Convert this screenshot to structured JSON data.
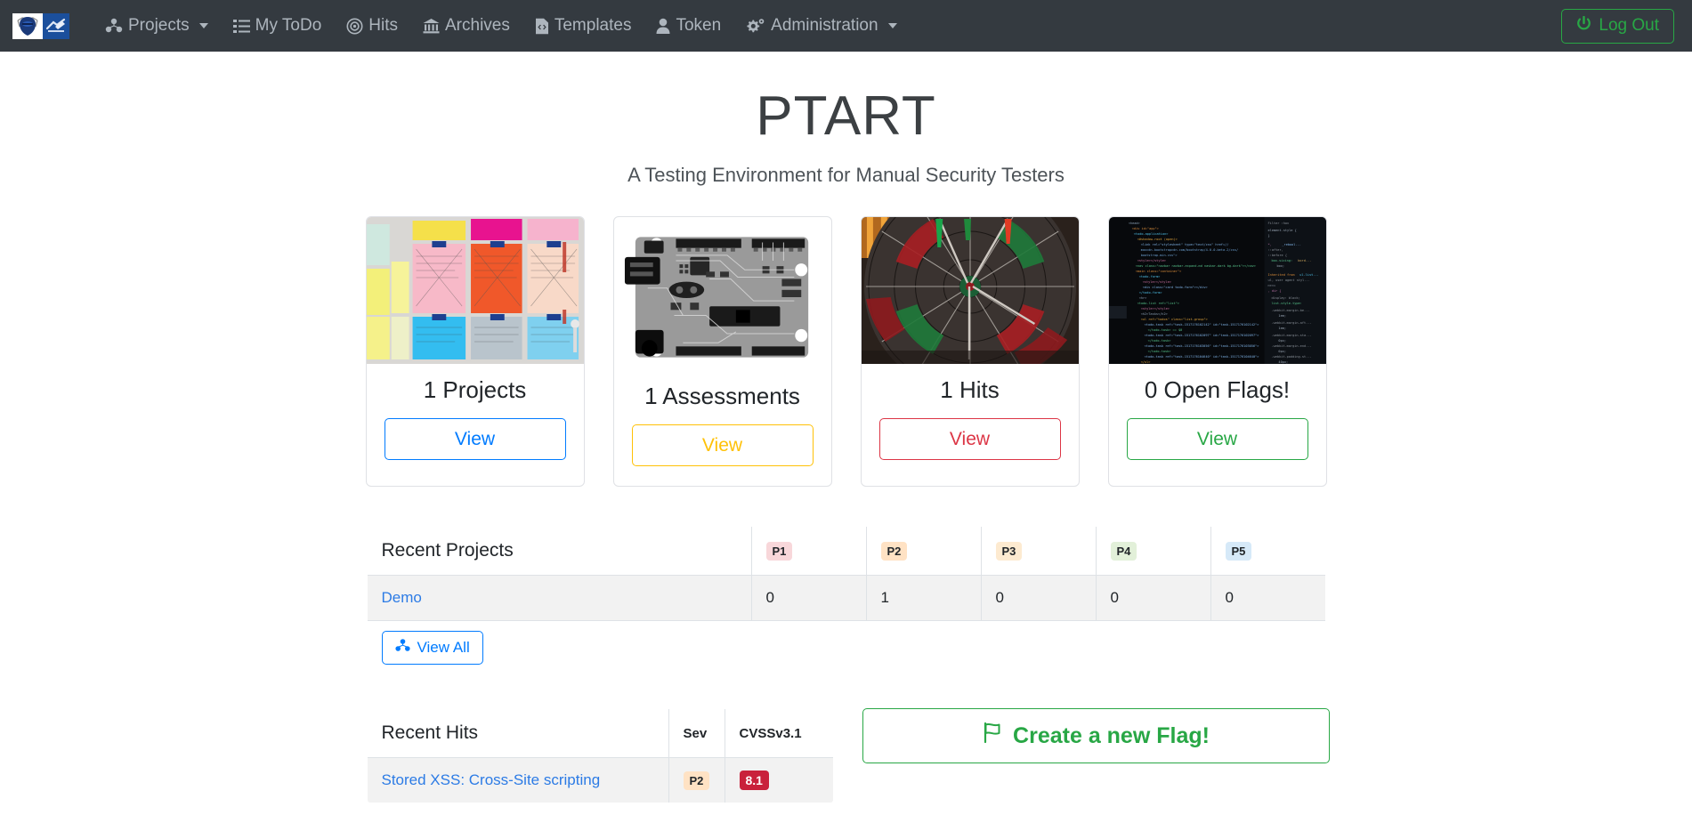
{
  "navbar": {
    "brand_name": "ptart-logo",
    "items": [
      {
        "label": "Projects",
        "icon": "cubes-icon",
        "has_caret": true
      },
      {
        "label": "My ToDo",
        "icon": "list-icon",
        "has_caret": false
      },
      {
        "label": "Hits",
        "icon": "target-icon",
        "has_caret": false
      },
      {
        "label": "Archives",
        "icon": "bank-icon",
        "has_caret": false
      },
      {
        "label": "Templates",
        "icon": "file-code-icon",
        "has_caret": false
      },
      {
        "label": "Token",
        "icon": "user-icon",
        "has_caret": false
      },
      {
        "label": "Administration",
        "icon": "cogs-icon",
        "has_caret": true
      }
    ],
    "logout_label": "Log Out",
    "logout_icon": "power-icon",
    "bg_color": "#343a40",
    "logout_color": "#28a745"
  },
  "hero": {
    "title": "PTART",
    "subtitle": "A Testing Environment for Manual Security Testers"
  },
  "cards": [
    {
      "title": "1 Projects",
      "button_label": "View",
      "color": "#007bff",
      "image": "sticky-notes-board-photo"
    },
    {
      "title": "1 Assessments",
      "button_label": "View",
      "color": "#ffc107",
      "image": "circuit-board-photo"
    },
    {
      "title": "1 Hits",
      "button_label": "View",
      "color": "#dc3545",
      "image": "dartboard-photo"
    },
    {
      "title": "0 Open Flags!",
      "button_label": "View",
      "color": "#28a745",
      "image": "code-screen-photo"
    }
  ],
  "recent_projects": {
    "heading": "Recent Projects",
    "columns": [
      {
        "label": "P1",
        "class": "bg-p1",
        "color": "#f8d7da"
      },
      {
        "label": "P2",
        "class": "bg-p2",
        "color": "#ffe2c4"
      },
      {
        "label": "P3",
        "class": "bg-p3",
        "color": "#fdead0"
      },
      {
        "label": "P4",
        "class": "bg-p4",
        "color": "#e2f0d9"
      },
      {
        "label": "P5",
        "class": "bg-p5",
        "color": "#d6e9f8"
      }
    ],
    "rows": [
      {
        "name": "Demo",
        "p1": "0",
        "p2": "1",
        "p3": "0",
        "p4": "0",
        "p5": "0"
      }
    ],
    "view_all_label": "View All",
    "view_all_icon": "cubes-icon"
  },
  "recent_hits": {
    "heading": "Recent Hits",
    "col_sev": "Sev",
    "col_cvss": "CVSSv3.1",
    "rows": [
      {
        "name": "Stored XSS: Cross-Site scripting",
        "sev": "P2",
        "cvss": "8.1"
      }
    ]
  },
  "flag_panel": {
    "button_label": "Create a new Flag!",
    "icon": "flag-icon",
    "color": "#28a745"
  }
}
